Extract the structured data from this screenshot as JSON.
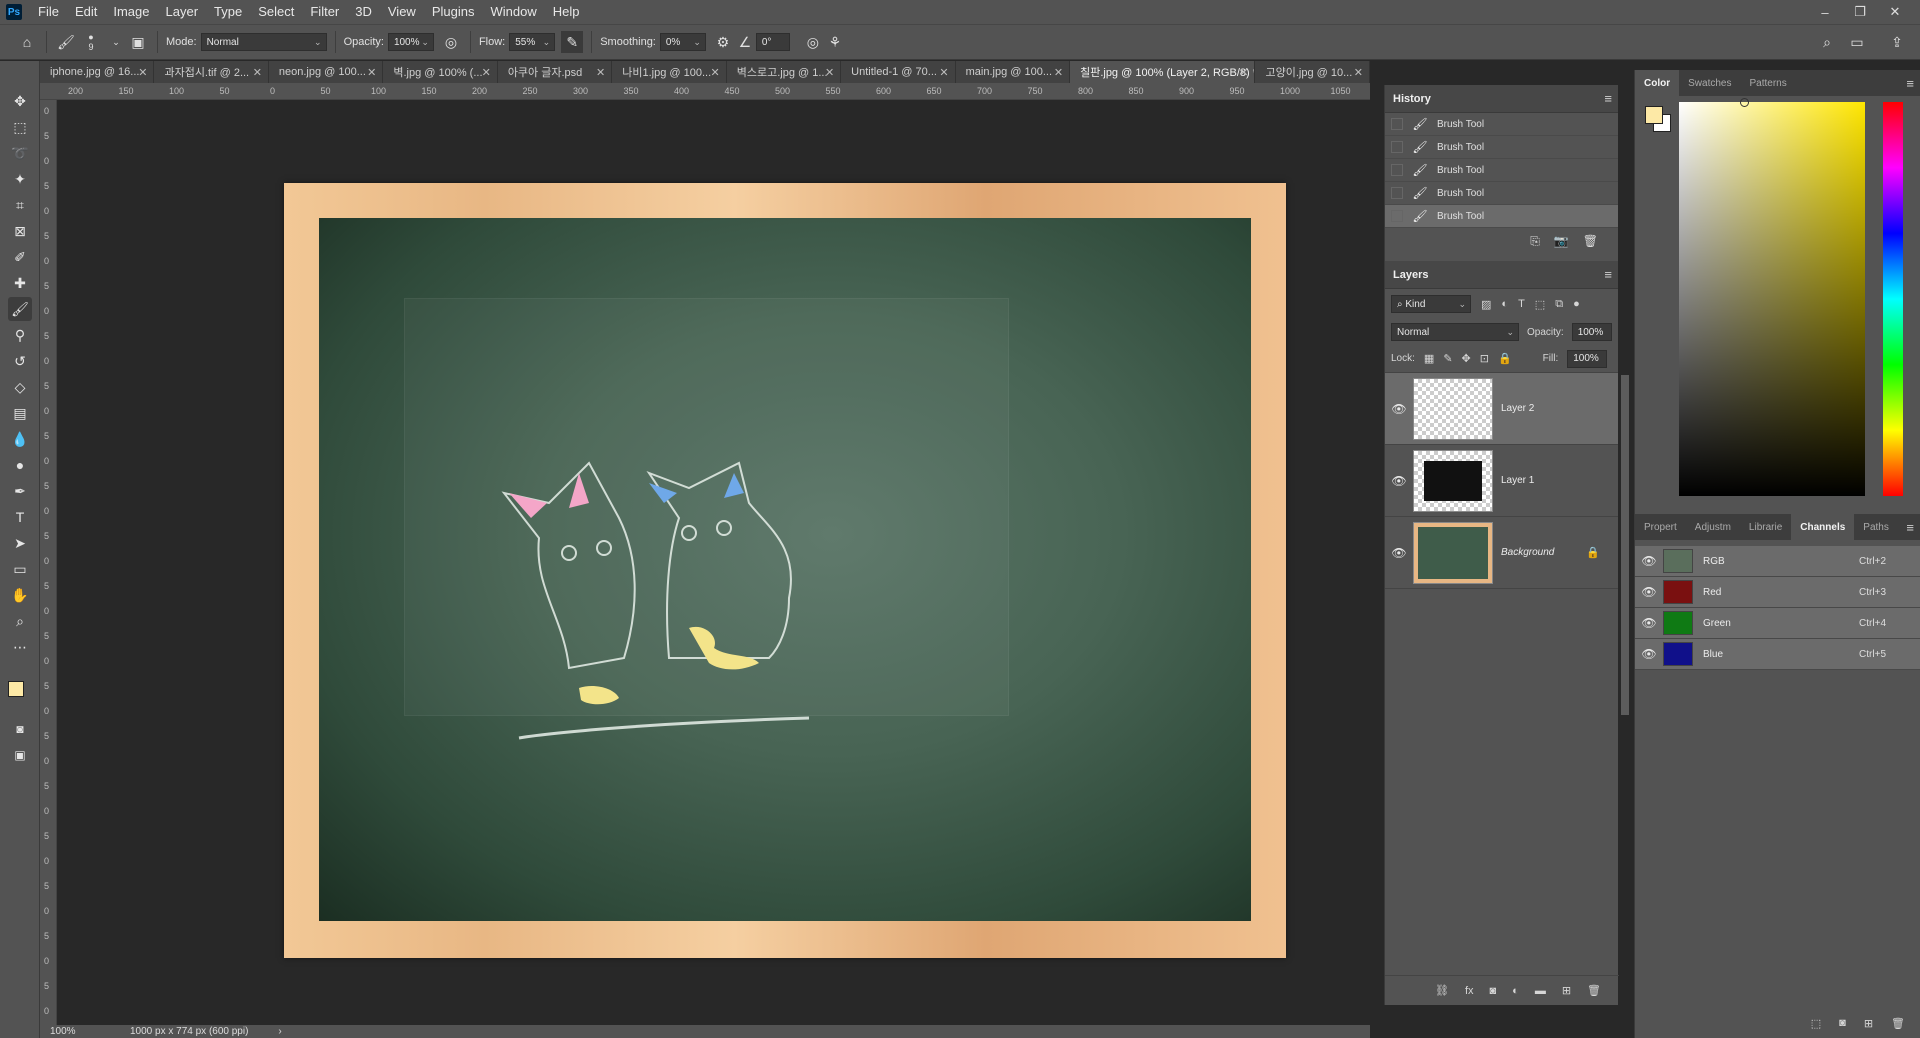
{
  "app": {
    "logo": "Ps"
  },
  "menu": [
    "File",
    "Edit",
    "Image",
    "Layer",
    "Type",
    "Select",
    "Filter",
    "3D",
    "View",
    "Plugins",
    "Window",
    "Help"
  ],
  "window_controls": {
    "minimize": "–",
    "restore": "❐",
    "close": "✕"
  },
  "options": {
    "brush_size": "9",
    "mode_label": "Mode:",
    "mode_value": "Normal",
    "opacity_label": "Opacity:",
    "opacity_value": "100%",
    "flow_label": "Flow:",
    "flow_value": "55%",
    "smoothing_label": "Smoothing:",
    "smoothing_value": "0%",
    "angle_value": "0°"
  },
  "tabs": [
    "iphone.jpg @ 16...",
    "과자접시.tif @ 2...",
    "neon.jpg @ 100...",
    "벽.jpg @ 100% (...",
    "아쿠아 글자.psd",
    "나비1.jpg @ 100...",
    "벽스로고.jpg @ 1...",
    "Untitled-1 @ 70...",
    "main.jpg @ 100...",
    "칠판.jpg @ 100% (Layer 2, RGB/8) *",
    "고양이.jpg @ 10..."
  ],
  "ruler_ticks": [
    "200",
    "150",
    "100",
    "50",
    "0",
    "50",
    "100",
    "150",
    "200",
    "250",
    "300",
    "350",
    "400",
    "450",
    "500",
    "550",
    "600",
    "650",
    "700",
    "750",
    "800",
    "850",
    "900",
    "950",
    "1000",
    "1050"
  ],
  "ruler_v_ticks": [
    "0",
    "5",
    "0",
    "5",
    "0",
    "5",
    "0",
    "5",
    "0",
    "5",
    "0",
    "5",
    "0",
    "5",
    "0",
    "5",
    "0",
    "5",
    "0",
    "5",
    "0",
    "5",
    "0",
    "5",
    "0",
    "5",
    "0",
    "5",
    "0",
    "5",
    "0",
    "5",
    "0",
    "5",
    "0",
    "5",
    "0"
  ],
  "status": {
    "zoom": "100%",
    "doc_info": "1000 px x 774 px (600 ppi)"
  },
  "history": {
    "title": "History",
    "items": [
      "Brush Tool",
      "Brush Tool",
      "Brush Tool",
      "Brush Tool",
      "Brush Tool"
    ]
  },
  "layers": {
    "title": "Layers",
    "filter_label": "Kind",
    "blend_mode": "Normal",
    "opacity_label": "Opacity:",
    "opacity_value": "100%",
    "lock_label": "Lock:",
    "fill_label": "Fill:",
    "fill_value": "100%",
    "items": [
      {
        "name": "Layer 2"
      },
      {
        "name": "Layer 1"
      },
      {
        "name": "Background"
      }
    ]
  },
  "color_panel": {
    "tabs": [
      "Color",
      "Swatches",
      "Patterns"
    ],
    "foreground": "#fde9a6",
    "background": "#ffffff"
  },
  "channels_panel": {
    "tabs": [
      "Propert",
      "Adjustm",
      "Librarie",
      "Channels",
      "Paths"
    ],
    "items": [
      {
        "name": "RGB",
        "shortcut": "Ctrl+2",
        "color": "#5a6e5c"
      },
      {
        "name": "Red",
        "shortcut": "Ctrl+3",
        "color": "#7a1010"
      },
      {
        "name": "Green",
        "shortcut": "Ctrl+4",
        "color": "#0f7a14"
      },
      {
        "name": "Blue",
        "shortcut": "Ctrl+5",
        "color": "#10108a"
      }
    ]
  }
}
